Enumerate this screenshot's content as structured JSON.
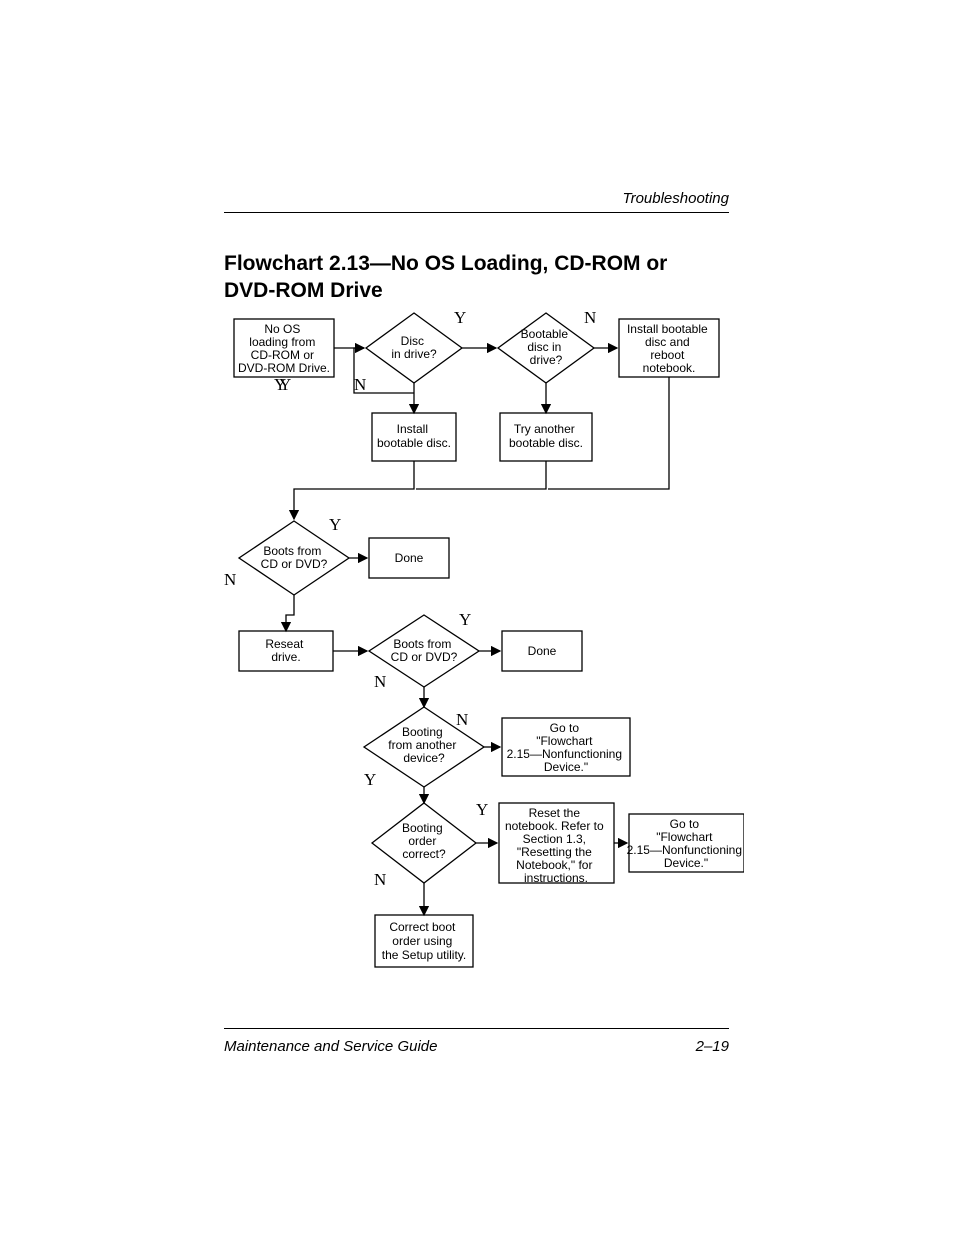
{
  "header": {
    "section": "Troubleshooting"
  },
  "title": "Flowchart 2.13—No OS Loading, CD-ROM or DVD-ROM Drive",
  "footer": {
    "left": "Maintenance and Service Guide",
    "right": "2–19"
  },
  "labels": {
    "Y": "Y",
    "N": "N"
  },
  "nodes": {
    "start": {
      "l1": "No OS",
      "l2": "loading from",
      "l3": "CD-ROM or",
      "l4": "DVD-ROM Drive."
    },
    "disc": {
      "l1": "Disc",
      "l2": "in drive?"
    },
    "bootable": {
      "l1": "Bootable",
      "l2": "disc in",
      "l3": "drive?"
    },
    "install_reboot": {
      "l1": "Install bootable",
      "l2": "disc and",
      "l3": "reboot",
      "l4": "notebook."
    },
    "install": {
      "l1": "Install",
      "l2": "bootable disc."
    },
    "tryanother": {
      "l1": "Try another",
      "l2": "bootable disc."
    },
    "boots1": {
      "l1": "Boots from",
      "l2": "CD or DVD?"
    },
    "done1": {
      "l1": "Done"
    },
    "reseat": {
      "l1": "Reseat",
      "l2": "drive."
    },
    "boots2": {
      "l1": "Boots from",
      "l2": "CD or DVD?"
    },
    "done2": {
      "l1": "Done"
    },
    "another": {
      "l1": "Booting",
      "l2": "from another",
      "l3": "device?"
    },
    "goto215a": {
      "pre": "Go to",
      "link1": "\"Flowchart",
      "link2": "2.15—Nonfunctioning",
      "link3": "Device.\""
    },
    "order": {
      "l1": "Booting",
      "l2": "order",
      "l3": "correct?"
    },
    "reset": {
      "l1": "Reset the",
      "l2": "notebook. Refer to",
      "link1": "Section 1.3,",
      "link2": "\"Resetting the",
      "link3": "Notebook,\"",
      "post": " for",
      "l3": "instructions."
    },
    "goto215b": {
      "pre": "Go to",
      "link1": "\"Flowchart",
      "link2": "2.15—Nonfunctioning",
      "link3": "Device.\""
    },
    "correct": {
      "l1": "Correct boot",
      "l2": "order using",
      "l3": "the Setup utility."
    }
  },
  "chart_data": {
    "type": "flowchart",
    "nodes": [
      {
        "id": "start",
        "kind": "process",
        "text": "No OS loading from CD-ROM or DVD-ROM Drive."
      },
      {
        "id": "disc",
        "kind": "decision",
        "text": "Disc in drive?"
      },
      {
        "id": "bootable",
        "kind": "decision",
        "text": "Bootable disc in drive?"
      },
      {
        "id": "install_reboot",
        "kind": "process",
        "text": "Install bootable disc and reboot notebook."
      },
      {
        "id": "install",
        "kind": "process",
        "text": "Install bootable disc."
      },
      {
        "id": "tryanother",
        "kind": "process",
        "text": "Try another bootable disc."
      },
      {
        "id": "boots1",
        "kind": "decision",
        "text": "Boots from CD or DVD?"
      },
      {
        "id": "done1",
        "kind": "terminator",
        "text": "Done"
      },
      {
        "id": "reseat",
        "kind": "process",
        "text": "Reseat drive."
      },
      {
        "id": "boots2",
        "kind": "decision",
        "text": "Boots from CD or DVD?"
      },
      {
        "id": "done2",
        "kind": "terminator",
        "text": "Done"
      },
      {
        "id": "another",
        "kind": "decision",
        "text": "Booting from another device?"
      },
      {
        "id": "goto215a",
        "kind": "process",
        "text": "Go to \"Flowchart 2.15—Nonfunctioning Device.\""
      },
      {
        "id": "order",
        "kind": "decision",
        "text": "Booting order correct?"
      },
      {
        "id": "reset",
        "kind": "process",
        "text": "Reset the notebook. Refer to Section 1.3, \"Resetting the Notebook,\" for instructions."
      },
      {
        "id": "goto215b",
        "kind": "process",
        "text": "Go to \"Flowchart 2.15—Nonfunctioning Device.\""
      },
      {
        "id": "correct",
        "kind": "process",
        "text": "Correct boot order using the Setup utility."
      }
    ],
    "edges": [
      {
        "from": "start",
        "to": "disc"
      },
      {
        "from": "disc",
        "to": "bootable",
        "label": "Y"
      },
      {
        "from": "disc",
        "to": "install",
        "label": "N"
      },
      {
        "from": "bootable",
        "to": "install_reboot",
        "label": "N"
      },
      {
        "from": "bootable",
        "to": "tryanother",
        "label": "Y"
      },
      {
        "from": "install",
        "to": "boots1"
      },
      {
        "from": "tryanother",
        "to": "boots1"
      },
      {
        "from": "install_reboot",
        "to": "boots1"
      },
      {
        "from": "boots1",
        "to": "done1",
        "label": "Y"
      },
      {
        "from": "boots1",
        "to": "reseat",
        "label": "N"
      },
      {
        "from": "reseat",
        "to": "boots2"
      },
      {
        "from": "boots2",
        "to": "done2",
        "label": "Y"
      },
      {
        "from": "boots2",
        "to": "another",
        "label": "N"
      },
      {
        "from": "another",
        "to": "goto215a",
        "label": "N"
      },
      {
        "from": "another",
        "to": "order",
        "label": "Y"
      },
      {
        "from": "order",
        "to": "reset",
        "label": "Y"
      },
      {
        "from": "order",
        "to": "correct",
        "label": "N"
      },
      {
        "from": "reset",
        "to": "goto215b"
      }
    ]
  }
}
